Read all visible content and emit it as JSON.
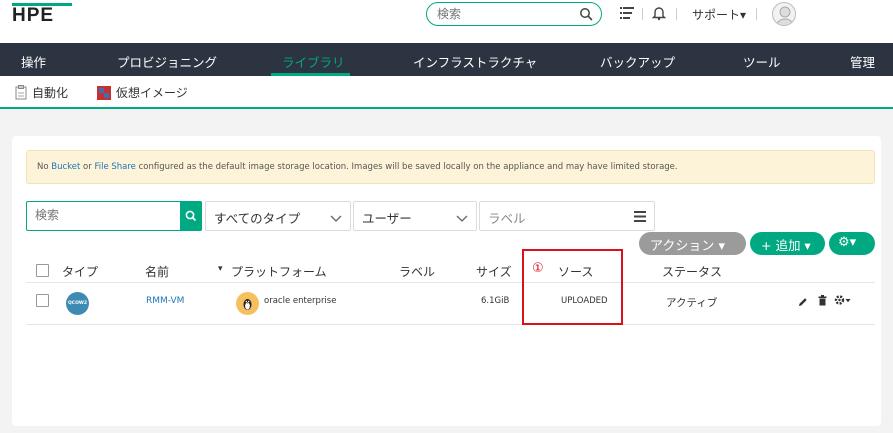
{
  "header": {
    "logo": "HPE",
    "search_placeholder": "検索",
    "support_label": "サポート▾"
  },
  "nav": {
    "items": [
      {
        "label": "操作"
      },
      {
        "label": "プロビジョニング"
      },
      {
        "label": "ライブラリ"
      },
      {
        "label": "インフラストラクチャ"
      },
      {
        "label": "バックアップ"
      },
      {
        "label": "ツール"
      },
      {
        "label": "管理"
      }
    ],
    "active": "ライブラリ"
  },
  "subnav": {
    "items": [
      {
        "label": "自動化",
        "icon": "clipboard-icon"
      },
      {
        "label": "仮想イメージ",
        "icon": "virtual-image-icon"
      }
    ]
  },
  "alert": {
    "prefix": "No ",
    "bucket": "Bucket",
    "or": " or ",
    "file_share": "File Share",
    "suffix": " configured as the default image storage location. Images will be saved locally on the appliance and may have limited storage."
  },
  "filters": {
    "search_placeholder": "検索",
    "type_select": "すべてのタイプ",
    "user_select": "ユーザー",
    "label_placeholder": "ラベル"
  },
  "actions": {
    "action_label": "アクション ▾",
    "add_label": "+ 追加 ▾",
    "settings_label": "⚙▾"
  },
  "table": {
    "columns": [
      "タイプ",
      "名前",
      "プラットフォーム",
      "ラベル",
      "サイズ",
      "ソース",
      "ステータス"
    ],
    "sort_indicator": "▾",
    "rows": [
      {
        "type_badge": "QCOW2",
        "name": "RMM-VM",
        "platform": "oracle enterprise",
        "label": "",
        "size": "6.1GiB",
        "source": "UPLOADED",
        "status": "アクティブ"
      }
    ]
  },
  "annotation": {
    "marker": "①"
  },
  "colors": {
    "accent": "#01a982",
    "nav_bg": "#2c3441",
    "highlight_red": "#d9111b",
    "action_gray": "#9b9b9b",
    "alert_bg": "#fdf3d8"
  }
}
